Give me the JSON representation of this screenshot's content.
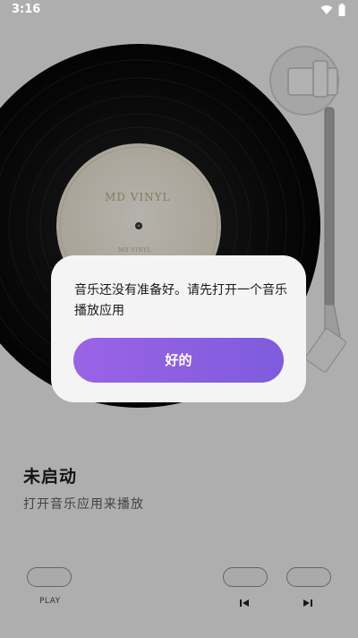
{
  "status_bar": {
    "time": "3:16",
    "icons": [
      "wifi-icon",
      "battery-icon"
    ]
  },
  "record": {
    "label_title": "MD VINYL",
    "label_small": "MD VINYL"
  },
  "player": {
    "title": "未启动",
    "subtitle": "打开音乐应用来播放",
    "play_label": "PLAY",
    "prev_icon": "skip-previous-icon",
    "next_icon": "skip-next-icon"
  },
  "dialog": {
    "message": "音乐还没有准备好。请先打开一个音乐播放应用",
    "ok_label": "好的"
  },
  "colors": {
    "accent_start": "#9b63e6",
    "accent_end": "#7d5cdc",
    "background": "#f2f2f2"
  }
}
